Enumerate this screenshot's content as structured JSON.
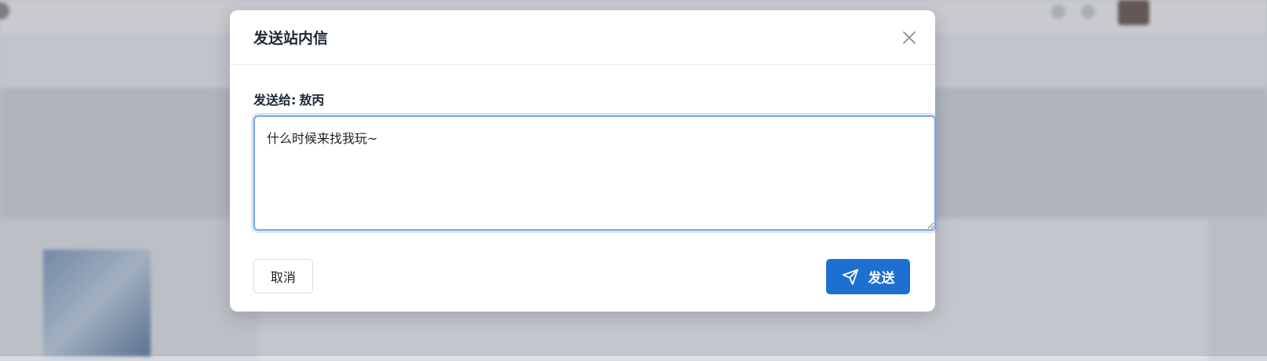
{
  "background": {
    "search_placeholder": "",
    "nav_items": [],
    "article_title": "",
    "article_meta": "",
    "body_snippet": ""
  },
  "modal": {
    "title": "发送站内信",
    "close_icon": "close-icon",
    "recipient_label": "发送给:",
    "recipient_name": "敖丙",
    "message_value": "什么时候来找我玩~",
    "cancel_label": "取消",
    "send_label": "发送",
    "send_icon": "paper-plane-icon",
    "accent_color": "#1d6fd1"
  }
}
